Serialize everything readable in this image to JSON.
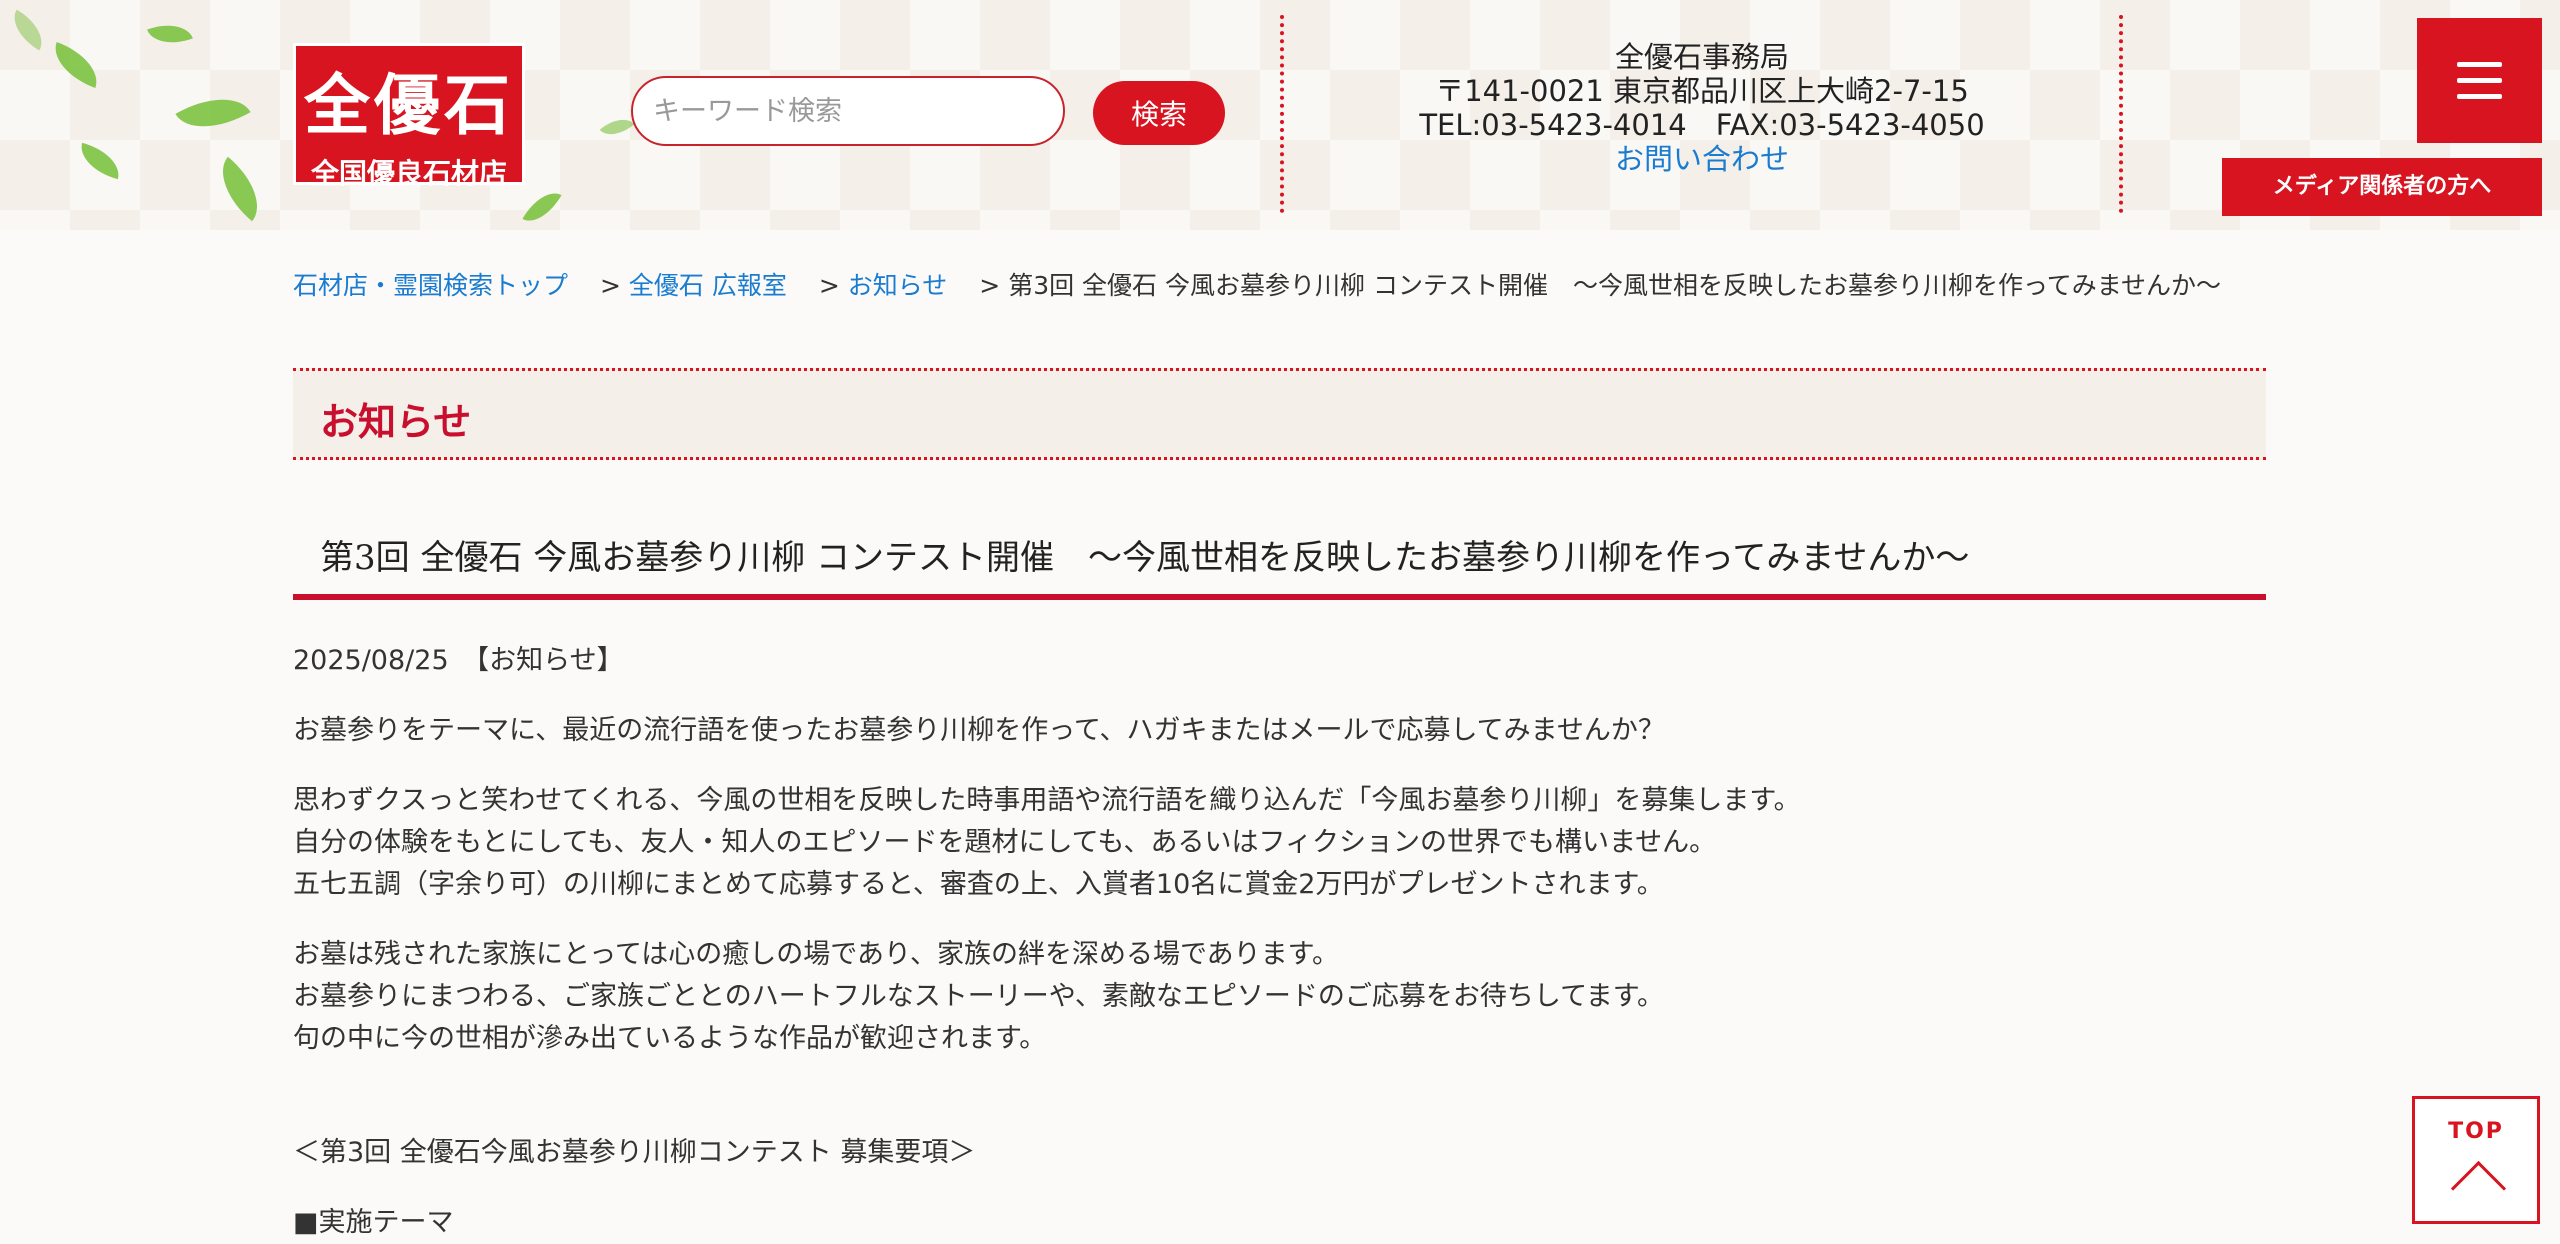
{
  "header": {
    "logo": {
      "main": "全優石",
      "sub": "全国優良石材店"
    },
    "search": {
      "placeholder": "キーワード検索",
      "button_label": "検索"
    },
    "office": {
      "name": "全優石事務局",
      "address": "〒141-0021 東京都品川区上大崎2-7-15",
      "phone_fax": "TEL:03-5423-4014　FAX:03-5423-4050",
      "contact_link": "お問い合わせ"
    },
    "media_button": "メディア関係者の方へ",
    "menu_icon": "hamburger-menu-icon"
  },
  "breadcrumb": {
    "items": [
      "石材店・霊園検索トップ",
      "全優石 広報室",
      "お知らせ"
    ],
    "separator": ">",
    "current": "第3回 全優石 今風お墓参り川柳 コンテスト開催　～今風世相を反映したお墓参り川柳を作ってみませんか～"
  },
  "section": {
    "heading": "お知らせ"
  },
  "article": {
    "title": "第3回 全優石 今風お墓参り川柳 コンテスト開催　～今風世相を反映したお墓参り川柳を作ってみませんか～",
    "meta": "2025/08/25　【お知らせ】",
    "paragraphs": [
      [
        "お墓参りをテーマに、最近の流行語を使ったお墓参り川柳を作って、ハガキまたはメールで応募してみませんか？"
      ],
      [
        "思わずクスっと笑わせてくれる、今風の世相を反映した時事用語や流行語を織り込んだ「今風お墓参り川柳」を募集します。",
        "自分の体験をもとにしても、友人・知人のエピソードを題材にしても、あるいはフィクションの世界でも構いません。",
        "五七五調（字余り可）の川柳にまとめて応募すると、審査の上、入賞者10名に賞金2万円がプレゼントされます。"
      ],
      [
        "お墓は残された家族にとっては心の癒しの場であり、家族の絆を深める場であります。",
        "お墓参りにまつわる、ご家族ごととのハートフルなストーリーや、素敵なエピソードのご応募をお待ちしてます。",
        "句の中に今の世相が滲み出ているような作品が歓迎されます。"
      ]
    ],
    "guidelines_heading": "＜第3回 全優石今風お墓参り川柳コンテスト 募集要項＞",
    "theme_heading": "■実施テーマ"
  },
  "top_button": {
    "label": "TOP"
  },
  "colors": {
    "accent": "#d7141f",
    "link": "#1a7cd0",
    "heading": "#c8102e"
  }
}
